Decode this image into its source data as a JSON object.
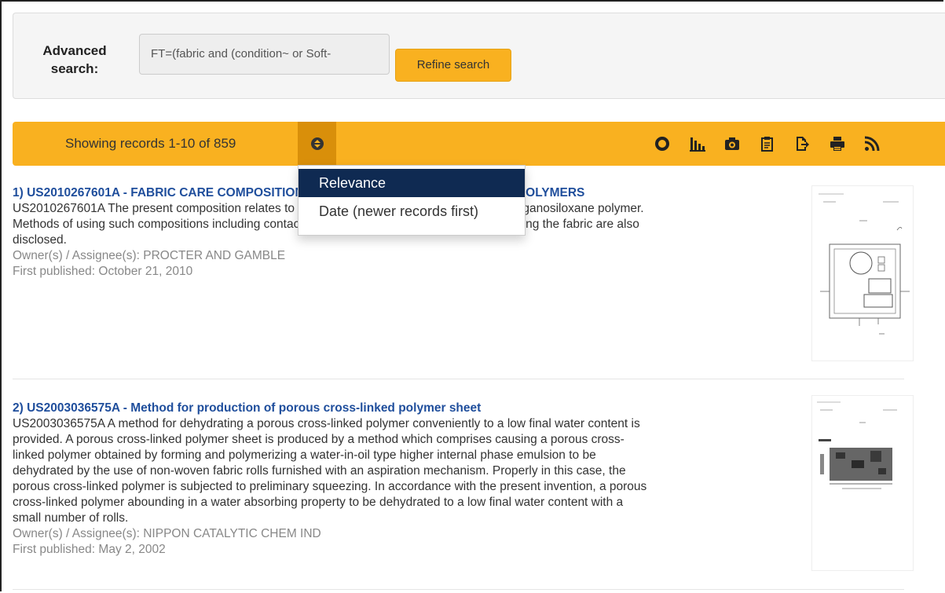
{
  "advanced_search": {
    "label": "Advanced search:",
    "query_value": "FT=(fabric and (condition~ or Soft-",
    "refine_label": "Refine search"
  },
  "toolbar": {
    "showing_text": "Showing records 1-10 of 859",
    "icons": [
      "refresh-icon",
      "bar-chart-icon",
      "camera-icon",
      "clipboard-icon",
      "export-icon",
      "print-icon",
      "rss-icon"
    ]
  },
  "sort_menu": {
    "options": [
      "Relevance",
      "Date (newer records first)"
    ],
    "selected": "Relevance"
  },
  "results": [
    {
      "title": "1) US2010267601A - FABRIC CARE COMPOSITIONS COMPRISING ORGANOSILOXANE POLYMERS",
      "abstract_lines": [
        "US2010267601A The present composition relates to fabric care compositions comprising an organosiloxane polymer.",
        "Methods of using such compositions including contacting a fabric with the composition and rinsing the fabric are also",
        "disclosed."
      ],
      "owner": "Owner(s) / Assignee(s): PROCTER AND GAMBLE",
      "published": "First published: October 21, 2010"
    },
    {
      "title": "2) US2003036575A - Method for production of porous cross-linked polymer sheet",
      "abstract_lines": [
        "US2003036575A A method for dehydrating a porous cross-linked polymer conveniently to a low final water content is",
        "provided. A porous cross-linked polymer sheet is produced by a method which comprises causing a porous cross-",
        "linked polymer obtained by forming and polymerizing a water-in-oil type higher internal phase emulsion to be",
        "dehydrated by the use of non-woven fabric rolls furnished with an aspiration mechanism. Properly in this case, the",
        "porous cross-linked polymer is subjected to preliminary squeezing. In accordance with the present invention, a porous",
        "cross-linked polymer abounding in a water absorbing property to be dehydrated to a low final water content with a",
        "small number of rolls."
      ],
      "owner": "Owner(s) / Assignee(s): NIPPON CATALYTIC CHEM IND",
      "published": "First published: May 2, 2002"
    }
  ],
  "colors": {
    "toolbar": "#f9b120",
    "sort_toggle": "#d98f0a",
    "link": "#1f4e9c",
    "menu_active": "#0f2a52"
  }
}
